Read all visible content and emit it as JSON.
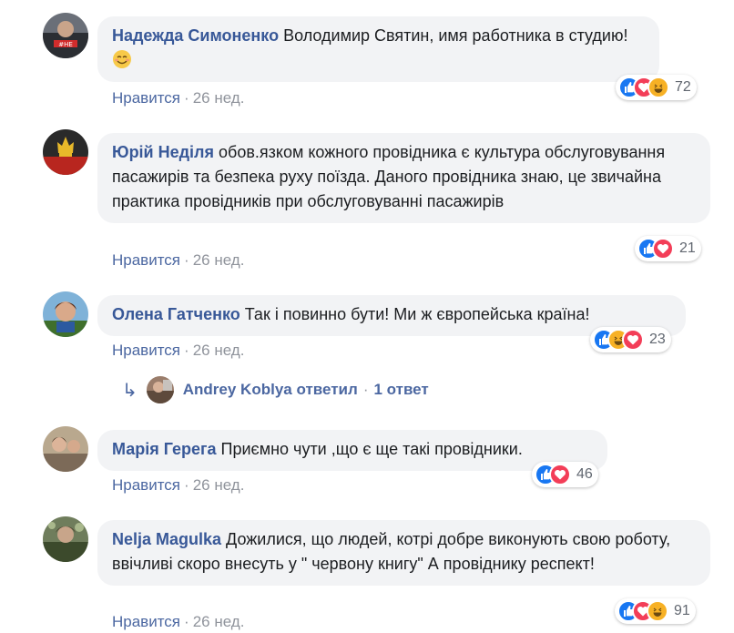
{
  "comments": [
    {
      "author": "Надежда Симоненко",
      "text": "Володимир Святин, имя работника в студию!",
      "like_label": "Нравится",
      "sep": "·",
      "time": "26 нед.",
      "reaction_count": "72",
      "reactions": [
        "like",
        "love",
        "haha"
      ]
    },
    {
      "author": "Юрій Неділя",
      "text": "обов.язком кожного провідника є культура обслуговування пасажирів та безпека руху поїзда. Даного провідника знаю, це звичайна практика провідників при обслуговуванні пасажирів",
      "like_label": "Нравится",
      "sep": "·",
      "time": "26 нед.",
      "reaction_count": "21",
      "reactions": [
        "like",
        "love"
      ]
    },
    {
      "author": "Олена Гатченко",
      "text": "Так і повинно бути! Ми ж європейська країна!",
      "like_label": "Нравится",
      "sep": "·",
      "time": "26 нед.",
      "reaction_count": "23",
      "reactions": [
        "like",
        "haha",
        "love"
      ]
    },
    {
      "author": "Марія Герега",
      "text": "Приємно чути ,що є ще такі провідники.",
      "like_label": "Нравится",
      "sep": "·",
      "time": "26 нед.",
      "reaction_count": "46",
      "reactions": [
        "like",
        "love"
      ]
    },
    {
      "author": "Nelja Magulka",
      "text": "Дожилися, що людей, котрі добре виконують свою роботу, ввічливі скоро внесуть у \" червону книгу\" А провіднику респект!",
      "like_label": "Нравится",
      "sep": "·",
      "time": "26 нед.",
      "reaction_count": "91",
      "reactions": [
        "like",
        "love",
        "haha"
      ]
    }
  ],
  "reply": {
    "author": "Andrey Koblya",
    "action": "ответил",
    "sep": "·",
    "count": "1 ответ"
  },
  "icons": {
    "reply_arrow": "reply-arrow-icon",
    "like": "like-reaction-icon",
    "love": "love-reaction-icon",
    "haha": "haha-reaction-icon",
    "smile_emoji": "smiling-emoji-icon"
  },
  "colors": {
    "author": "#385898",
    "bubble": "#f2f3f5",
    "meta": "#90949c",
    "like_link": "#4b67a1",
    "like_reaction": "#1877f2",
    "love_reaction": "#f33e58",
    "haha_reaction": "#f7b125"
  }
}
